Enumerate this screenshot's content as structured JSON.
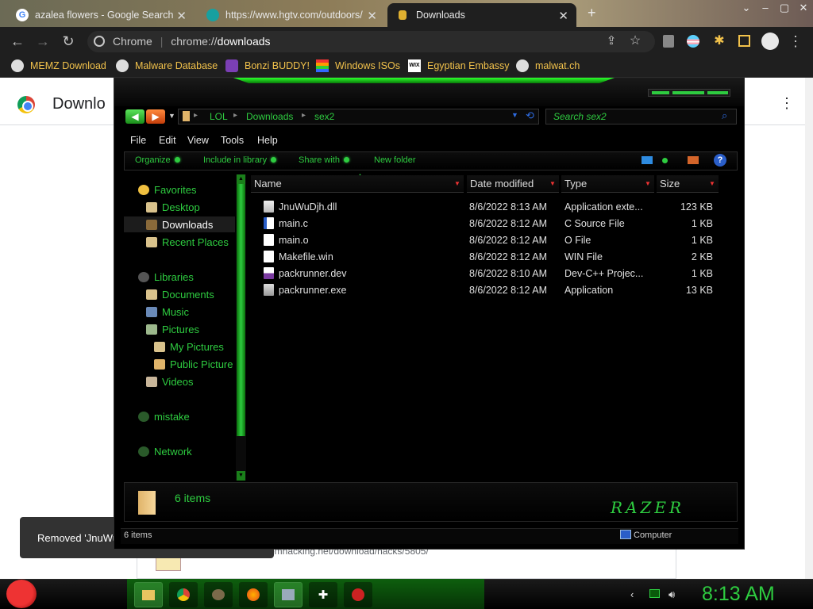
{
  "browser": {
    "tabs": [
      {
        "title": "azalea flowers - Google Search",
        "favicon": "google-icon"
      },
      {
        "title": "https://www.hgtv.com/outdoors/",
        "favicon": "hgtv-icon"
      },
      {
        "title": "Downloads",
        "favicon": "downloads-icon",
        "active": true
      }
    ],
    "new_tab_symbol": "+",
    "omnibox": {
      "label": "Chrome",
      "scheme": "chrome://",
      "path": "downloads"
    },
    "bookmarks": [
      {
        "label": "MEMZ Download",
        "icon": "globe-icon"
      },
      {
        "label": "Malware Database",
        "icon": "globe-icon"
      },
      {
        "label": "Bonzi BUDDY!",
        "icon": "bonzi-icon"
      },
      {
        "label": "Windows ISOs",
        "icon": "windows-icon"
      },
      {
        "label": "Egyptian Embassy",
        "icon": "wix-icon"
      },
      {
        "label": "malwat.ch",
        "icon": "globe-icon"
      }
    ]
  },
  "downloads_page": {
    "title": "Downlo",
    "card_url": "romhacking.net/download/hacks/5805/",
    "toast": "Removed 'JnuWuDjh.dll'"
  },
  "explorer": {
    "breadcrumbs": [
      "LOL",
      "Downloads",
      "sex2"
    ],
    "search_placeholder": "Search sex2",
    "menu": [
      "File",
      "Edit",
      "View",
      "Tools",
      "Help"
    ],
    "commands": [
      "Organize",
      "Include in library",
      "Share with",
      "New folder"
    ],
    "help_label": "?",
    "nav": {
      "favorites": {
        "label": "Favorites",
        "items": [
          "Desktop",
          "Downloads",
          "Recent Places"
        ]
      },
      "libraries": {
        "label": "Libraries",
        "items": [
          "Documents",
          "Music",
          "Pictures",
          "My Pictures",
          "Public Picture",
          "Videos"
        ]
      },
      "mistake": "mistake",
      "network": "Network"
    },
    "columns": [
      "Name",
      "Date modified",
      "Type",
      "Size"
    ],
    "files": [
      {
        "name": "JnuWuDjh.dll",
        "date": "8/6/2022 8:13 AM",
        "type": "Application exte...",
        "size": "123 KB",
        "icon": "dll-file-icon"
      },
      {
        "name": "main.c",
        "date": "8/6/2022 8:12 AM",
        "type": "C Source File",
        "size": "1 KB",
        "icon": "c-file-icon"
      },
      {
        "name": "main.o",
        "date": "8/6/2022 8:12 AM",
        "type": "O File",
        "size": "1 KB",
        "icon": "file-icon"
      },
      {
        "name": "Makefile.win",
        "date": "8/6/2022 8:12 AM",
        "type": "WIN File",
        "size": "2 KB",
        "icon": "file-icon"
      },
      {
        "name": "packrunner.dev",
        "date": "8/6/2022 8:10 AM",
        "type": "Dev-C++ Projec...",
        "size": "1 KB",
        "icon": "dev-file-icon"
      },
      {
        "name": "packrunner.exe",
        "date": "8/6/2022 8:12 AM",
        "type": "Application",
        "size": "13 KB",
        "icon": "exe-file-icon"
      }
    ],
    "details_count": "6 items",
    "logo_text": "RAZER",
    "status_items": "6 items",
    "status_location": "Computer"
  },
  "taskbar": {
    "clock": "8:13 AM",
    "apps": [
      "explorer-icon",
      "chrome-icon",
      "paint-icon",
      "firefox-icon",
      "control-panel-icon",
      "game-icon",
      "devcpp-icon"
    ]
  }
}
